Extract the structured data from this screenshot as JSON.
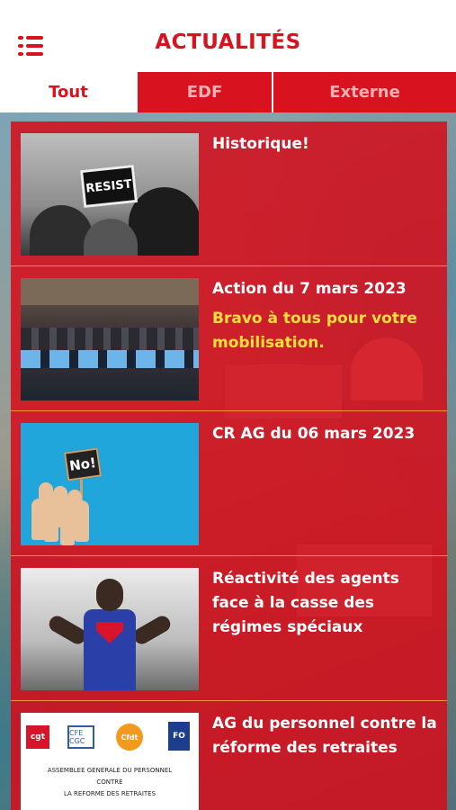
{
  "header": {
    "title": "ACTUALITÉS",
    "menu_icon": "hamburger-menu-icon"
  },
  "tabs": [
    {
      "label": "Tout",
      "active": true
    },
    {
      "label": "EDF",
      "active": false
    },
    {
      "label": "Externe",
      "active": false
    }
  ],
  "colors": {
    "brand_red": "#d9121f",
    "highlight_yellow": "#ffe13a",
    "inactive_tab_text": "#f3b0b4"
  },
  "news": [
    {
      "title": "Historique!",
      "subtitle": "",
      "thumb_text": "RESIST"
    },
    {
      "title": "Action du 7 mars 2023",
      "subtitle": "Bravo à tous pour votre mobilisation."
    },
    {
      "title": "CR AG du 06 mars 2023",
      "subtitle": "",
      "thumb_text": "No!"
    },
    {
      "title": "Réactivité des agents face à la casse des régimes spéciaux",
      "subtitle": ""
    },
    {
      "title": "AG du personnel contre la réforme des retraites",
      "subtitle": "",
      "thumb_logos": [
        "cgt",
        "CFE CGC",
        "Cfdt",
        "FO"
      ],
      "thumb_lines": [
        "ASSEMBLEE GENERALE DU PERSONNEL",
        "CONTRE",
        "LA REFORME DES RETRAITES"
      ]
    }
  ]
}
